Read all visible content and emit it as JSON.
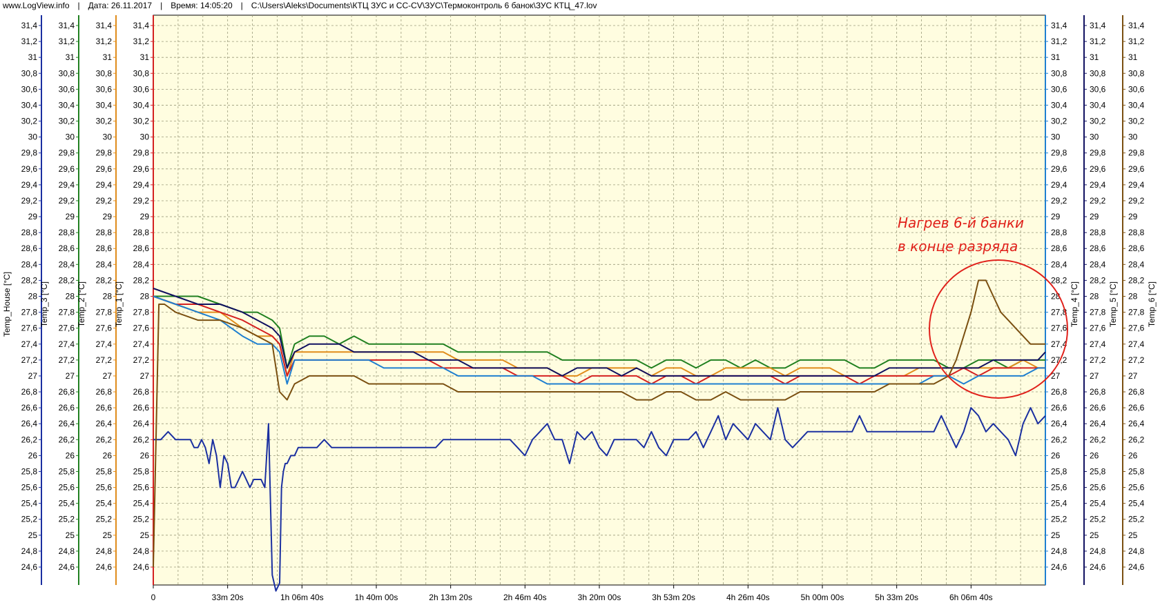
{
  "header": {
    "site": "www.LogView.info",
    "date": "Дата: 26.11.2017",
    "time": "Время: 14:05:20",
    "path": "C:\\Users\\Aleks\\Documents\\КТЦ ЗУС и СС-СV\\ЗУС\\Термоконтроль 6 банок\\ЗУС КТЦ_47.lov"
  },
  "annotation": {
    "line1": "Нагрев 6-й банки",
    "line2": "в конце разряда",
    "color": "#e0201a"
  },
  "chart_data": {
    "type": "line",
    "plot_background": "#fffde0",
    "grid": true,
    "x_unit": "seconds",
    "xlim": [
      0,
      24000
    ],
    "ylim": [
      24.5,
      31.5
    ],
    "x_tick_values": [
      0,
      2000,
      4000,
      6000,
      8000,
      10000,
      12000,
      14000,
      16000,
      18000,
      20000,
      22000
    ],
    "x_tick_labels": [
      "0",
      "33m 20s",
      "1h 06m 40s",
      "1h 40m 00s",
      "2h 13m 20s",
      "2h 46m 40s",
      "3h 20m 00s",
      "3h 53m 20s",
      "4h 26m 40s",
      "5h 00m 00s",
      "5h 33m 20s",
      "6h 06m 40s"
    ],
    "y_tick_labels": [
      "31,4",
      "31,2",
      "31",
      "30,8",
      "30,6",
      "30,4",
      "30,2",
      "30",
      "29,8",
      "29,6",
      "29,4",
      "29,2",
      "29",
      "28,8",
      "28,6",
      "28,4",
      "28,2",
      "28",
      "27,8",
      "27,6",
      "27,4",
      "27,2",
      "27",
      "26,8",
      "26,6",
      "26,4",
      "26,2",
      "26",
      "25,8",
      "25,6",
      "25,4",
      "25,2",
      "25",
      "24,8",
      "24,6"
    ],
    "y_tick_values": [
      31.4,
      31.2,
      31.0,
      30.8,
      30.6,
      30.4,
      30.2,
      30.0,
      29.8,
      29.6,
      29.4,
      29.2,
      29.0,
      28.8,
      28.6,
      28.4,
      28.2,
      28.0,
      27.8,
      27.6,
      27.4,
      27.2,
      27.0,
      26.8,
      26.6,
      26.4,
      26.2,
      26.0,
      25.8,
      25.6,
      25.4,
      25.2,
      25.0,
      24.8,
      24.6
    ],
    "left_axes": [
      {
        "name": "Temp_House [°C]",
        "color": "#1a2fa0"
      },
      {
        "name": "Temp_3 [°C]",
        "color": "#208020"
      },
      {
        "name": "Temp_2 [°C]",
        "color": "#e08c1a"
      },
      {
        "name": "Temp_1 [°C]",
        "color": "#d42020"
      }
    ],
    "right_axes": [
      {
        "name": "Temp_4 [°C]",
        "color": "#1e7fd0"
      },
      {
        "name": "Temp_5 [°C]",
        "color": "#101060"
      },
      {
        "name": "Temp_6 [°C]",
        "color": "#7a4f10"
      }
    ],
    "series": [
      {
        "name": "Temp_House",
        "color": "#1a2fa0",
        "x": [
          0,
          100,
          200,
          400,
          600,
          800,
          1000,
          1100,
          1200,
          1300,
          1400,
          1500,
          1600,
          1700,
          1800,
          1900,
          2000,
          2100,
          2200,
          2400,
          2600,
          2700,
          2800,
          2900,
          3000,
          3100,
          3200,
          3300,
          3400,
          3450,
          3500,
          3550,
          3600,
          3700,
          3800,
          3900,
          4000,
          4200,
          4400,
          4600,
          4800,
          5000,
          5200,
          5400,
          5600,
          5800,
          6000,
          6200,
          6400,
          6600,
          6800,
          7000,
          7200,
          7400,
          7600,
          7800,
          8000,
          8200,
          8400,
          8600,
          8800,
          9000,
          9200,
          9400,
          9600,
          9800,
          10000,
          10200,
          10400,
          10600,
          10800,
          11000,
          11200,
          11400,
          11600,
          11800,
          12000,
          12200,
          12400,
          12600,
          12800,
          13000,
          13200,
          13400,
          13600,
          13800,
          14000,
          14200,
          14400,
          14600,
          14800,
          15000,
          15200,
          15400,
          15600,
          15800,
          16000,
          16200,
          16400,
          16600,
          16800,
          17000,
          17200,
          17400,
          17600,
          17800,
          18000,
          18200,
          18400,
          18600,
          18800,
          19000,
          19200,
          19400,
          19600,
          19800,
          20000,
          20200,
          20400,
          20600,
          20800,
          21000,
          21200,
          21400,
          21600,
          21800,
          22000,
          22200,
          22400,
          22600,
          22800,
          23000,
          23200,
          23400,
          23600,
          23800,
          24000
        ],
        "y": [
          26.2,
          26.2,
          26.2,
          26.3,
          26.2,
          26.2,
          26.2,
          26.1,
          26.1,
          26.2,
          26.1,
          25.9,
          26.2,
          26.0,
          25.6,
          26.0,
          25.9,
          25.6,
          25.6,
          25.8,
          25.6,
          25.7,
          25.7,
          25.7,
          25.6,
          26.4,
          24.5,
          24.3,
          24.4,
          25.6,
          25.8,
          25.9,
          25.9,
          26.0,
          26.0,
          26.1,
          26.1,
          26.1,
          26.1,
          26.2,
          26.1,
          26.1,
          26.1,
          26.1,
          26.1,
          26.1,
          26.1,
          26.1,
          26.1,
          26.1,
          26.1,
          26.1,
          26.1,
          26.1,
          26.1,
          26.2,
          26.2,
          26.2,
          26.2,
          26.2,
          26.2,
          26.2,
          26.2,
          26.2,
          26.2,
          26.1,
          26.0,
          26.2,
          26.3,
          26.4,
          26.2,
          26.2,
          25.9,
          26.3,
          26.2,
          26.3,
          26.1,
          26.0,
          26.2,
          26.2,
          26.2,
          26.2,
          26.1,
          26.3,
          26.1,
          26.0,
          26.2,
          26.2,
          26.2,
          26.3,
          26.1,
          26.3,
          26.5,
          26.2,
          26.4,
          26.3,
          26.2,
          26.4,
          26.3,
          26.2,
          26.6,
          26.2,
          26.1,
          26.2,
          26.3,
          26.3,
          26.3,
          26.3,
          26.3,
          26.3,
          26.3,
          26.5,
          26.3,
          26.3,
          26.3,
          26.3,
          26.3,
          26.3,
          26.3,
          26.3,
          26.3,
          26.3,
          26.5,
          26.3,
          26.1,
          26.3,
          26.6,
          26.5,
          26.3,
          26.4,
          26.3,
          26.2,
          26.0,
          26.4,
          26.6,
          26.4,
          26.5
        ]
      },
      {
        "name": "Temp_3",
        "color": "#208020",
        "x": [
          0,
          600,
          1200,
          1800,
          2400,
          2800,
          3200,
          3400,
          3600,
          3800,
          4200,
          4600,
          5000,
          5400,
          5800,
          6200,
          6600,
          7000,
          7400,
          7800,
          8200,
          8600,
          9000,
          9400,
          9800,
          10200,
          10600,
          11000,
          11400,
          11800,
          12200,
          12600,
          13000,
          13400,
          13800,
          14200,
          14600,
          15000,
          15400,
          15800,
          16200,
          16600,
          17000,
          17400,
          17800,
          18200,
          18600,
          19000,
          19400,
          19800,
          20200,
          20600,
          21000,
          21400,
          21800,
          22200,
          22600,
          23000,
          23400,
          23800,
          24000
        ],
        "y": [
          28.0,
          28.0,
          28.0,
          27.9,
          27.8,
          27.8,
          27.7,
          27.6,
          27.1,
          27.4,
          27.5,
          27.5,
          27.4,
          27.5,
          27.4,
          27.4,
          27.4,
          27.4,
          27.4,
          27.4,
          27.3,
          27.3,
          27.3,
          27.3,
          27.3,
          27.3,
          27.3,
          27.2,
          27.2,
          27.2,
          27.2,
          27.2,
          27.2,
          27.1,
          27.2,
          27.2,
          27.1,
          27.2,
          27.2,
          27.1,
          27.2,
          27.1,
          27.1,
          27.2,
          27.2,
          27.2,
          27.2,
          27.1,
          27.1,
          27.2,
          27.2,
          27.2,
          27.2,
          27.1,
          27.1,
          27.2,
          27.2,
          27.1,
          27.2,
          27.2,
          27.2
        ]
      },
      {
        "name": "Temp_2",
        "color": "#e08c1a",
        "x": [
          0,
          600,
          1200,
          1800,
          2400,
          2800,
          3200,
          3400,
          3600,
          3800,
          4200,
          4600,
          5000,
          5400,
          5800,
          6200,
          6600,
          7000,
          7400,
          7800,
          8200,
          8600,
          9000,
          9400,
          9800,
          10200,
          10600,
          11000,
          11400,
          11800,
          12200,
          12600,
          13000,
          13400,
          13800,
          14200,
          14600,
          15000,
          15400,
          15800,
          16200,
          16600,
          17000,
          17400,
          17800,
          18200,
          18600,
          19000,
          19400,
          19800,
          20200,
          20600,
          21000,
          21400,
          21800,
          22200,
          22600,
          23000,
          23400,
          23800,
          24000
        ],
        "y": [
          28.0,
          27.9,
          27.8,
          27.8,
          27.6,
          27.5,
          27.5,
          27.4,
          27.0,
          27.3,
          27.3,
          27.3,
          27.3,
          27.3,
          27.3,
          27.3,
          27.3,
          27.3,
          27.3,
          27.3,
          27.2,
          27.2,
          27.2,
          27.2,
          27.1,
          27.1,
          27.1,
          27.0,
          27.0,
          27.1,
          27.1,
          27.1,
          27.1,
          27.0,
          27.1,
          27.1,
          27.0,
          27.0,
          27.1,
          27.1,
          27.1,
          27.1,
          27.0,
          27.1,
          27.1,
          27.1,
          27.0,
          27.0,
          27.0,
          27.0,
          27.0,
          27.1,
          27.1,
          27.1,
          27.1,
          27.1,
          27.1,
          27.1,
          27.2,
          27.1,
          27.1
        ]
      },
      {
        "name": "Temp_1",
        "color": "#d42020",
        "x": [
          0,
          600,
          1200,
          1800,
          2400,
          2800,
          3200,
          3400,
          3600,
          3800,
          4200,
          4600,
          5000,
          5400,
          5800,
          6200,
          6600,
          7000,
          7400,
          7800,
          8200,
          8600,
          9000,
          9400,
          9800,
          10200,
          10600,
          11000,
          11400,
          11800,
          12200,
          12600,
          13000,
          13400,
          13800,
          14200,
          14600,
          15000,
          15400,
          15800,
          16200,
          16600,
          17000,
          17400,
          17800,
          18200,
          18600,
          19000,
          19400,
          19800,
          20200,
          20600,
          21000,
          21400,
          21800,
          22200,
          22600,
          23000,
          23400,
          23800,
          24000
        ],
        "y": [
          28.0,
          27.9,
          27.9,
          27.8,
          27.7,
          27.6,
          27.5,
          27.4,
          27.0,
          27.2,
          27.2,
          27.2,
          27.2,
          27.2,
          27.2,
          27.2,
          27.2,
          27.2,
          27.2,
          27.1,
          27.1,
          27.1,
          27.1,
          27.1,
          27.0,
          27.0,
          27.0,
          27.0,
          26.9,
          27.0,
          27.0,
          27.0,
          27.0,
          26.9,
          27.0,
          27.0,
          26.9,
          27.0,
          27.0,
          27.0,
          27.0,
          27.0,
          26.9,
          27.0,
          27.0,
          27.0,
          27.0,
          26.9,
          27.0,
          27.0,
          27.0,
          27.0,
          27.0,
          27.0,
          27.1,
          27.0,
          27.1,
          27.1,
          27.1,
          27.1,
          27.1
        ]
      },
      {
        "name": "Temp_4",
        "color": "#1e7fd0",
        "x": [
          0,
          600,
          1200,
          1800,
          2400,
          2800,
          3200,
          3400,
          3600,
          3800,
          4200,
          4600,
          5000,
          5400,
          5800,
          6200,
          6600,
          7000,
          7400,
          7800,
          8200,
          8600,
          9000,
          9400,
          9800,
          10200,
          10600,
          11000,
          11400,
          11800,
          12200,
          12600,
          13000,
          13400,
          13800,
          14200,
          14600,
          15000,
          15400,
          15800,
          16200,
          16600,
          17000,
          17400,
          17800,
          18200,
          18600,
          19000,
          19400,
          19800,
          20200,
          20600,
          21000,
          21400,
          21800,
          22200,
          22600,
          23000,
          23400,
          23800,
          24000
        ],
        "y": [
          28.0,
          27.9,
          27.8,
          27.7,
          27.5,
          27.4,
          27.4,
          27.3,
          26.9,
          27.2,
          27.2,
          27.2,
          27.2,
          27.2,
          27.2,
          27.1,
          27.1,
          27.1,
          27.1,
          27.1,
          27.0,
          27.0,
          27.0,
          27.0,
          27.0,
          27.0,
          26.9,
          26.9,
          26.9,
          26.9,
          26.9,
          26.9,
          26.9,
          26.9,
          26.9,
          26.9,
          26.9,
          26.9,
          26.9,
          26.9,
          26.9,
          26.9,
          26.9,
          26.9,
          26.9,
          26.9,
          26.9,
          26.9,
          26.9,
          26.9,
          26.9,
          26.9,
          27.0,
          27.0,
          26.9,
          27.0,
          27.0,
          27.0,
          27.0,
          27.1,
          27.1
        ]
      },
      {
        "name": "Temp_5",
        "color": "#101060",
        "x": [
          0,
          600,
          1200,
          1800,
          2400,
          2800,
          3200,
          3400,
          3600,
          3800,
          4200,
          4600,
          5000,
          5400,
          5800,
          6200,
          6600,
          7000,
          7400,
          7800,
          8200,
          8600,
          9000,
          9400,
          9800,
          10200,
          10600,
          11000,
          11400,
          11800,
          12200,
          12600,
          13000,
          13400,
          13800,
          14200,
          14600,
          15000,
          15400,
          15800,
          16200,
          16600,
          17000,
          17400,
          17800,
          18200,
          18600,
          19000,
          19400,
          19800,
          20200,
          20600,
          21000,
          21400,
          21800,
          22200,
          22600,
          23000,
          23400,
          23800,
          24000
        ],
        "y": [
          28.1,
          28.0,
          27.9,
          27.9,
          27.8,
          27.7,
          27.6,
          27.5,
          27.1,
          27.3,
          27.4,
          27.4,
          27.4,
          27.3,
          27.3,
          27.3,
          27.3,
          27.3,
          27.2,
          27.2,
          27.2,
          27.1,
          27.1,
          27.1,
          27.1,
          27.1,
          27.1,
          27.0,
          27.1,
          27.1,
          27.1,
          27.0,
          27.1,
          27.0,
          27.0,
          27.0,
          27.0,
          27.0,
          27.0,
          27.0,
          27.0,
          27.0,
          27.0,
          27.0,
          27.0,
          27.0,
          27.0,
          27.0,
          27.0,
          27.1,
          27.1,
          27.1,
          27.1,
          27.1,
          27.1,
          27.1,
          27.2,
          27.2,
          27.2,
          27.2,
          27.3
        ]
      },
      {
        "name": "Temp_6",
        "color": "#7a4f10",
        "x": [
          0,
          150,
          300,
          600,
          1200,
          1800,
          2400,
          2800,
          3200,
          3400,
          3600,
          3800,
          4200,
          4600,
          5000,
          5400,
          5800,
          6200,
          6600,
          7000,
          7400,
          7800,
          8200,
          8600,
          9000,
          9400,
          9800,
          10200,
          10600,
          11000,
          11400,
          11800,
          12200,
          12600,
          13000,
          13400,
          13800,
          14200,
          14600,
          15000,
          15400,
          15800,
          16200,
          16600,
          17000,
          17400,
          17800,
          18200,
          18600,
          19000,
          19400,
          19800,
          20200,
          20600,
          21000,
          21400,
          21600,
          21800,
          22000,
          22200,
          22400,
          22600,
          22800,
          23000,
          23200,
          23400,
          23600,
          23800,
          24000
        ],
        "y": [
          24.6,
          27.9,
          27.9,
          27.8,
          27.7,
          27.7,
          27.6,
          27.5,
          27.4,
          26.8,
          26.7,
          26.9,
          27.0,
          27.0,
          27.0,
          27.0,
          26.9,
          26.9,
          26.9,
          26.9,
          26.9,
          26.9,
          26.8,
          26.8,
          26.8,
          26.8,
          26.8,
          26.8,
          26.8,
          26.8,
          26.8,
          26.8,
          26.8,
          26.8,
          26.7,
          26.7,
          26.8,
          26.8,
          26.7,
          26.7,
          26.8,
          26.7,
          26.7,
          26.7,
          26.7,
          26.8,
          26.8,
          26.8,
          26.8,
          26.8,
          26.8,
          26.9,
          26.9,
          26.9,
          26.9,
          27.0,
          27.2,
          27.5,
          27.8,
          28.2,
          28.2,
          28.0,
          27.8,
          27.7,
          27.6,
          27.5,
          27.4,
          27.4,
          27.4
        ]
      }
    ]
  }
}
